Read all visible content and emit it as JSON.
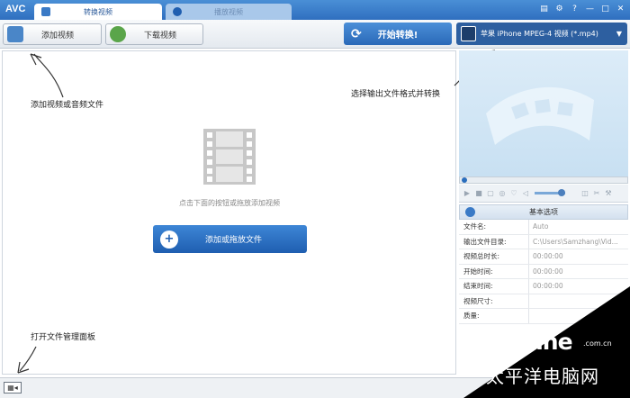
{
  "titlebar": {
    "logo": "AVC",
    "tabs": [
      {
        "label": "转换视频"
      },
      {
        "label": "播放视频"
      }
    ]
  },
  "toolbar": {
    "add_video": "添加视频",
    "download_video": "下载视频",
    "start_convert": "开始转换!",
    "format": "苹果 iPhone MPEG-4 视频 (*.mp4)"
  },
  "annotations": {
    "add_files": "添加视频或音频文件",
    "select_format": "选择输出文件格式并转换",
    "open_panel": "打开文件管理面板"
  },
  "main": {
    "hint": "点击下面的按钮或拖放添加视频",
    "add_file_button": "添加或拖放文件"
  },
  "options": {
    "header": "基本选项",
    "rows": [
      {
        "key": "文件名:",
        "value": "Auto"
      },
      {
        "key": "输出文件目录:",
        "value": "C:\\Users\\Samzhang\\Vid..."
      },
      {
        "key": "视频总时长:",
        "value": "00:00:00"
      },
      {
        "key": "开始时间:",
        "value": "00:00:00"
      },
      {
        "key": "结束时间:",
        "value": "00:00:00"
      },
      {
        "key": "视频尺寸:",
        "value": ""
      },
      {
        "key": "质量:",
        "value": ""
      }
    ]
  },
  "watermark": {
    "logo": "PConline",
    "com": ".com.cn",
    "cn": "太平洋电脑网"
  }
}
